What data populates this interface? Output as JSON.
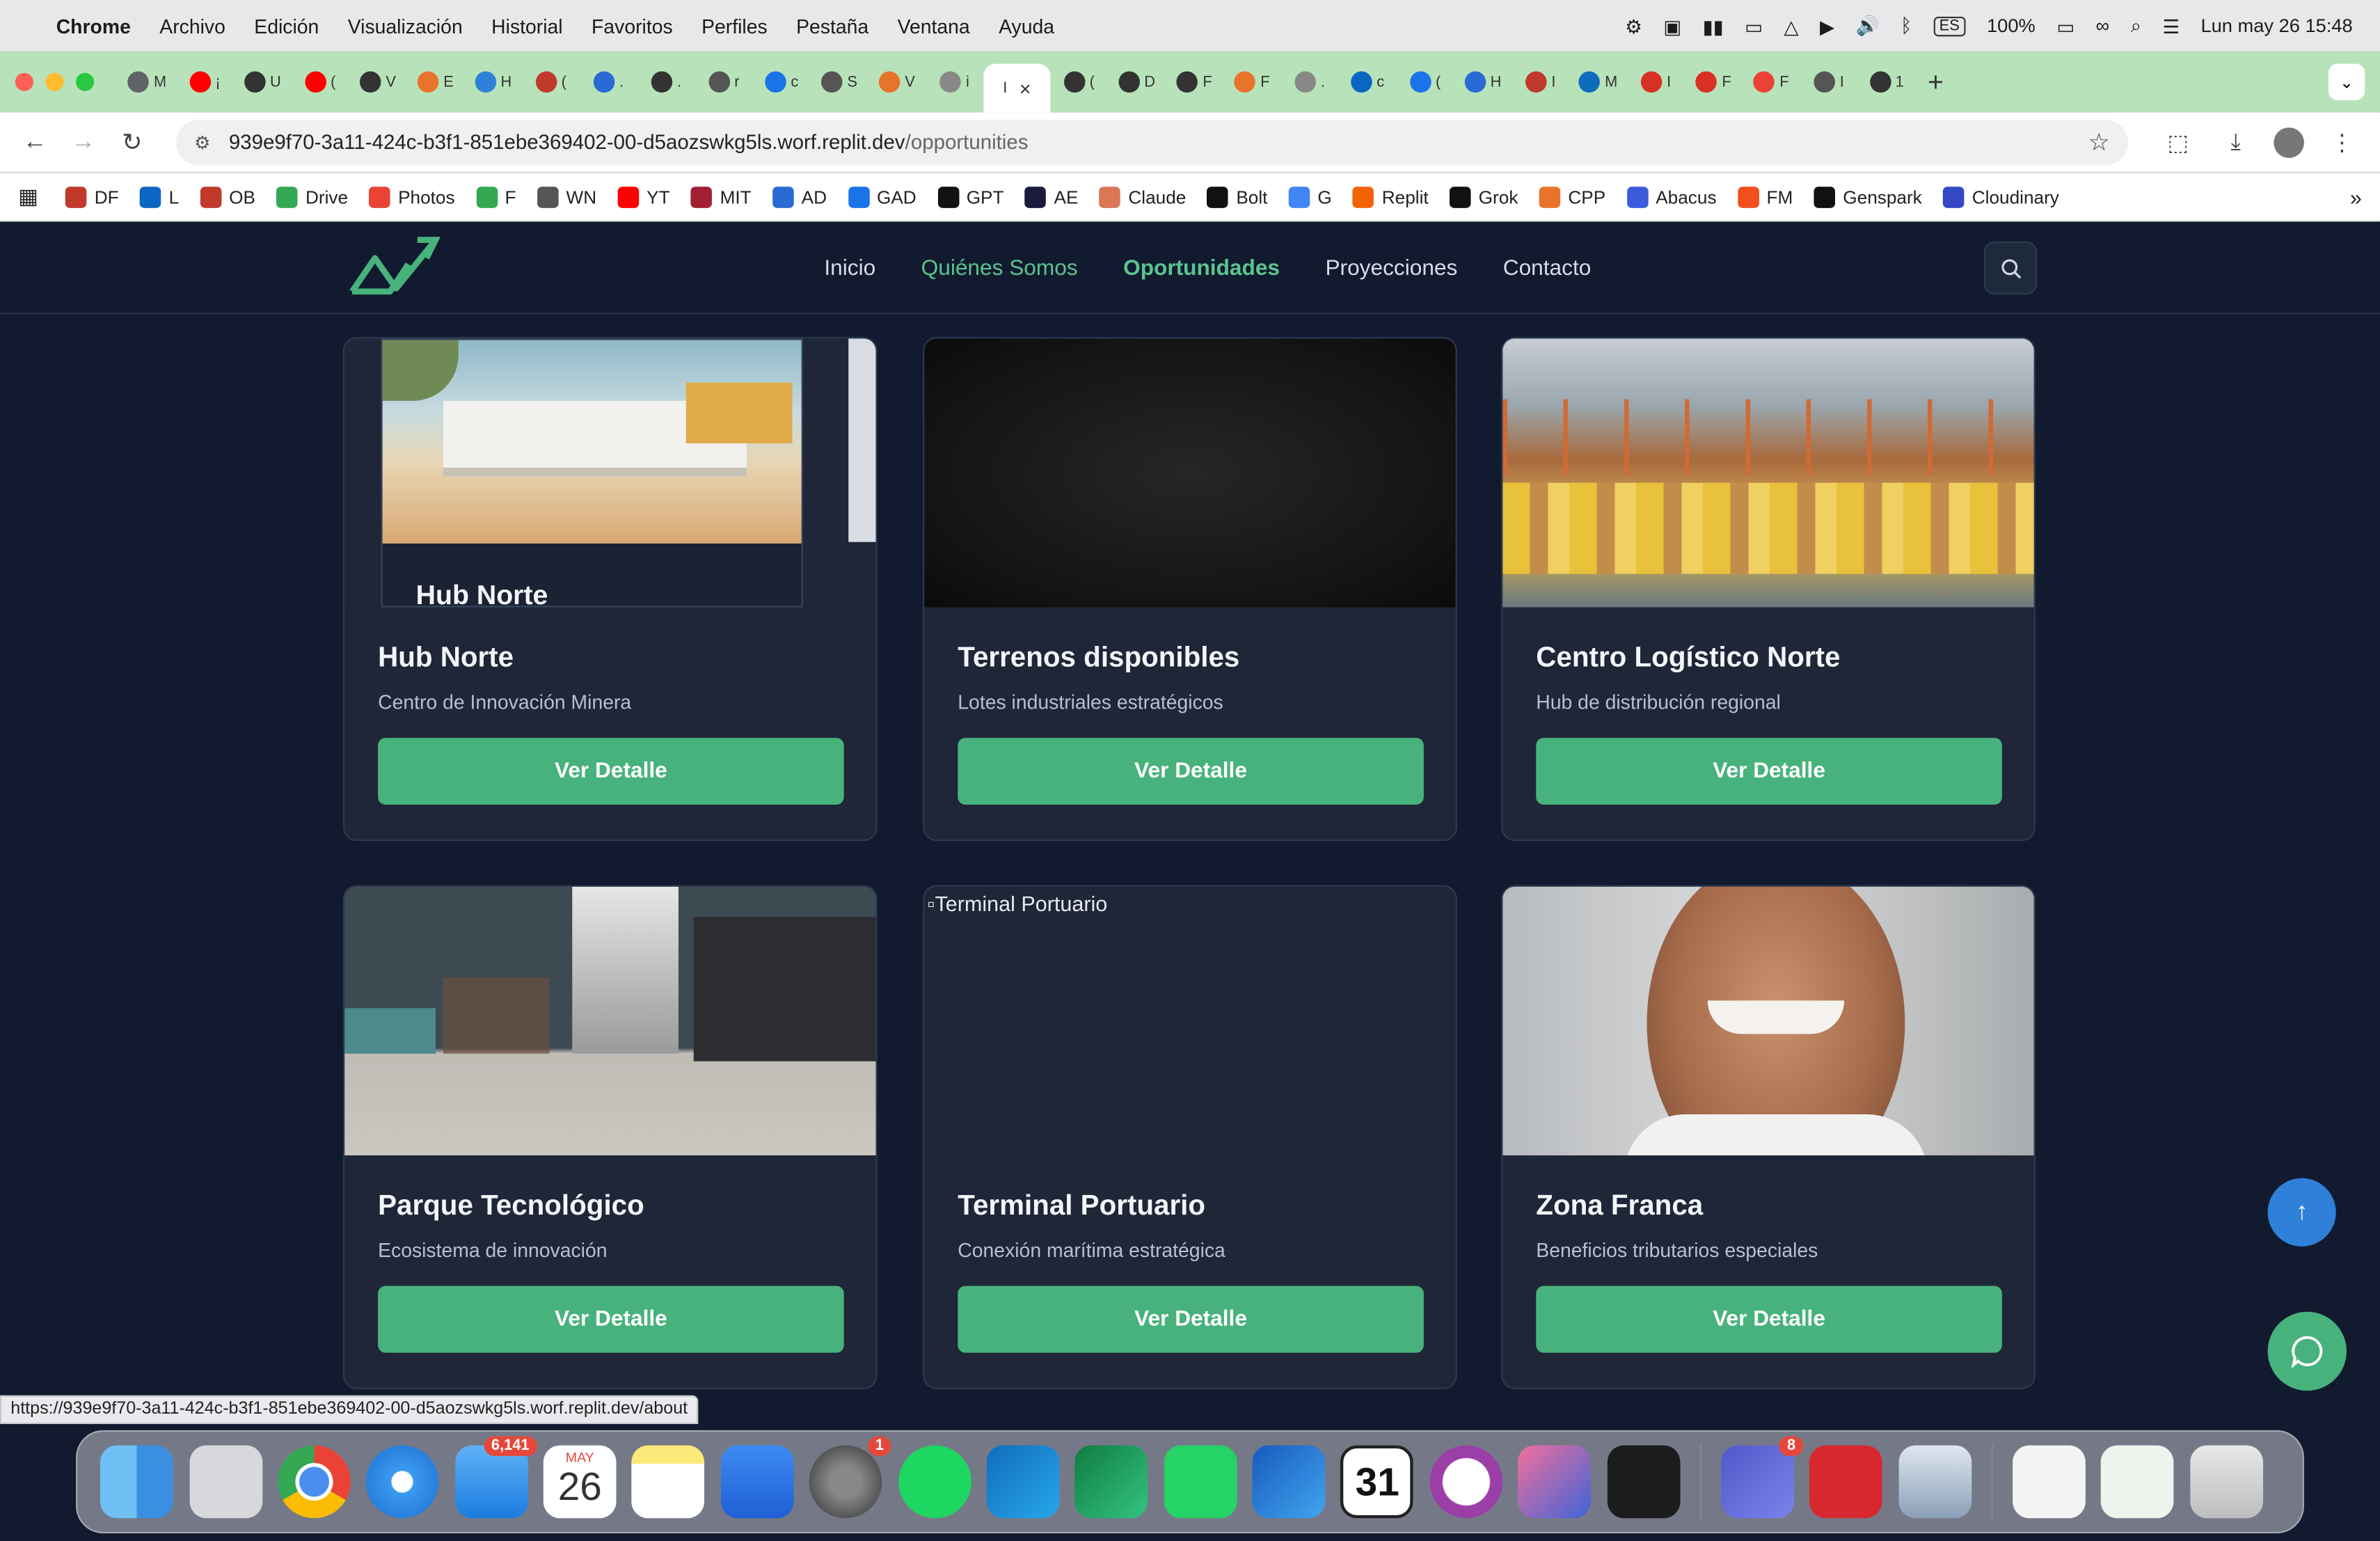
{
  "menubar": {
    "app": "Chrome",
    "menus": [
      "Archivo",
      "Edición",
      "Visualización",
      "Historial",
      "Favoritos",
      "Perfiles",
      "Pestaña",
      "Ventana",
      "Ayuda"
    ],
    "input_source": "ES",
    "battery": "100%",
    "datetime": "Lun may 26  15:48"
  },
  "tabs": [
    "M",
    "¡",
    "U",
    "(",
    "V",
    "E",
    "H",
    "(",
    ".",
    ".",
    "r",
    "c",
    "S",
    "V",
    "i",
    "I",
    "(",
    "D",
    "F",
    "F",
    ".",
    "c",
    "(",
    "H",
    "I",
    "M",
    "I",
    "F",
    "F",
    "I",
    "1"
  ],
  "tabs_active_index": 15,
  "address": {
    "host": "939e9f70-3a11-424c-b3f1-851ebe369402-00-d5aozswkg5ls.worf.replit.dev",
    "path": "/opportunities"
  },
  "bookmarks": [
    "DF",
    "L",
    "OB",
    "Drive",
    "Photos",
    "F",
    "WN",
    "YT",
    "MIT",
    "AD",
    "GAD",
    "GPT",
    "AE",
    "Claude",
    "Bolt",
    "G",
    "Replit",
    "Grok",
    "CPP",
    "Abacus",
    "FM",
    "Genspark",
    "Cloudinary"
  ],
  "nav": {
    "links": [
      "Inicio",
      "Quiénes Somos",
      "Oportunidades",
      "Proyecciones",
      "Contacto"
    ]
  },
  "cards": [
    {
      "title": "Hub Norte",
      "subtitle": "Centro de Innovación Minera",
      "button": "Ver Detalle",
      "inner_caption": "Hub Norte"
    },
    {
      "title": "Terrenos disponibles",
      "subtitle": "Lotes industriales estratégicos",
      "button": "Ver Detalle"
    },
    {
      "title": "Centro Logístico Norte",
      "subtitle": "Hub de distribución regional",
      "button": "Ver Detalle"
    },
    {
      "title": "Parque Tecnológico",
      "subtitle": "Ecosistema de innovación",
      "button": "Ver Detalle"
    },
    {
      "title": "Terminal Portuario",
      "subtitle": "Conexión marítima estratégica",
      "button": "Ver Detalle",
      "broken_alt": "Terminal Portuario"
    },
    {
      "title": "Zona Franca",
      "subtitle": "Beneficios tributarios especiales",
      "button": "Ver Detalle"
    }
  ],
  "status_url": "https://939e9f70-3a11-424c-b3f1-851ebe369402-00-d5aozswkg5ls.worf.replit.dev/about",
  "dock": {
    "mail_badge": "6,141",
    "calendar_month": "MAY",
    "calendar_day": "26",
    "settings_badge": "1",
    "teams_badge": "8",
    "ical_day": "31"
  },
  "colors": {
    "accent": "#48b27c",
    "page_bg": "#111a2e",
    "card_bg": "#1e2638",
    "fab_blue": "#2f80d8",
    "tab_strip": "#b8e3ba"
  }
}
